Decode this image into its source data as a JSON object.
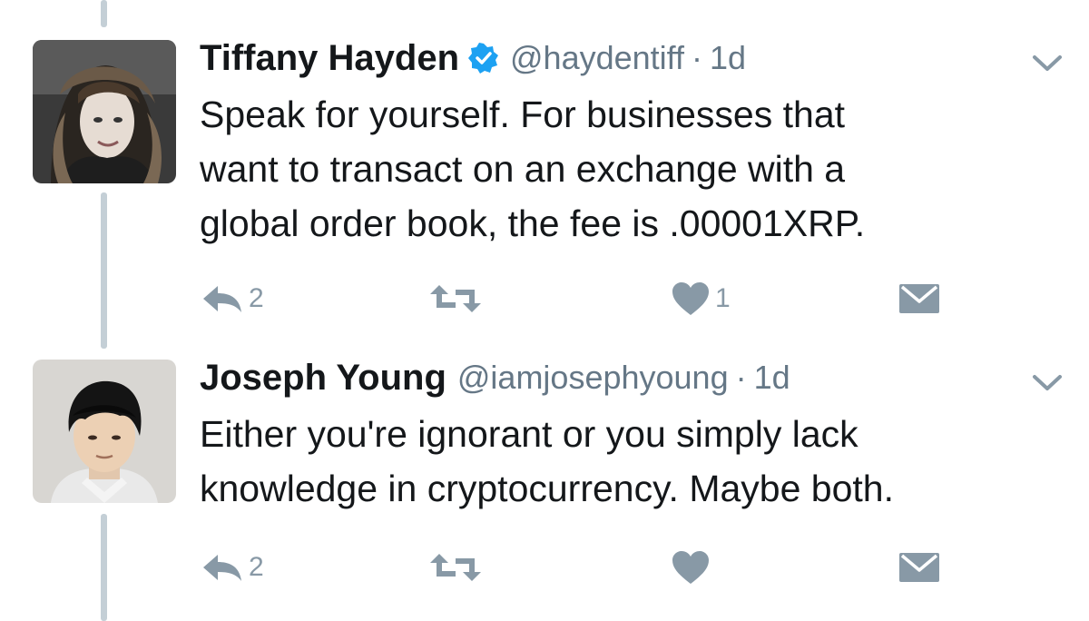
{
  "tweets": [
    {
      "author": {
        "name": "Tiffany Hayden",
        "handle": "@haydentiff",
        "verified": true,
        "avatar": "avatar-woman-photo"
      },
      "separator": "·",
      "time": "1d",
      "text_lines": [
        "Speak for yourself. For businesses that",
        "want to transact on an exchange with a",
        "global order book, the fee is .00001XRP."
      ],
      "actions": {
        "reply_count": "2",
        "retweet_count": "",
        "like_count": "1"
      }
    },
    {
      "author": {
        "name": "Joseph Young",
        "handle": "@iamjosephyoung",
        "verified": false,
        "avatar": "avatar-man-photo"
      },
      "separator": "·",
      "time": "1d",
      "text_lines": [
        "Either you're ignorant or you simply lack",
        "knowledge in cryptocurrency. Maybe both."
      ],
      "actions": {
        "reply_count": "2",
        "retweet_count": "",
        "like_count": ""
      }
    }
  ],
  "icons": {
    "reply": "reply-icon",
    "retweet": "retweet-icon",
    "like": "heart-icon",
    "dm": "envelope-icon",
    "caret": "chevron-down-icon",
    "verified": "verified-badge-icon"
  },
  "colors": {
    "action_icon": "#8899a6",
    "thread_line": "#c4cfd6",
    "verified": "#1da1f2",
    "handle": "#657786",
    "text": "#14171a"
  }
}
